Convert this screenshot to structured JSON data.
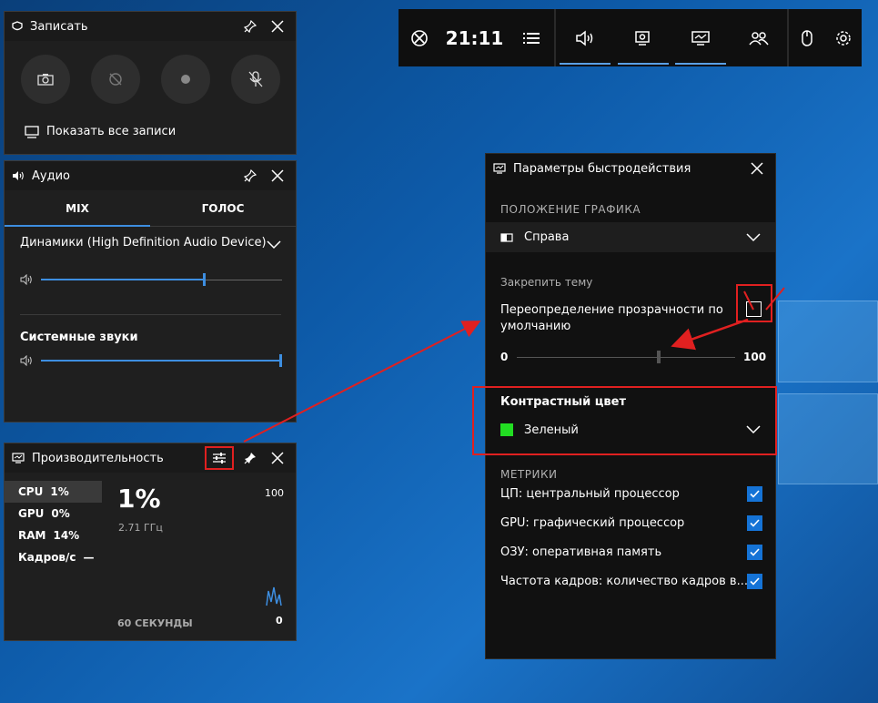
{
  "topbar": {
    "time": "21:11"
  },
  "record": {
    "title": "Записать",
    "show_all": "Показать все записи"
  },
  "audio": {
    "title": "Аудио",
    "tab_mix": "MIX",
    "tab_voice": "ГОЛОС",
    "device": "Динамики (High Definition Audio Device)",
    "system_sounds": "Системные звуки",
    "device_volume": 0.67,
    "system_volume": 1.0
  },
  "perf": {
    "title": "Производительность",
    "stats": [
      {
        "label": "CPU",
        "value": "1%"
      },
      {
        "label": "GPU",
        "value": "0%"
      },
      {
        "label": "RAM",
        "value": "14%"
      },
      {
        "label": "Кадров/с",
        "value": "—"
      }
    ],
    "big_value": "1%",
    "freq": "2.71 ГГц",
    "max": "100",
    "min": "0",
    "duration": "60 СЕКУНДЫ"
  },
  "settings": {
    "title": "Параметры быстродействия",
    "section_position": "ПОЛОЖЕНИЕ ГРАФИКА",
    "position_value": "Справа",
    "lock_theme": "Закрепить тему",
    "transparency_label_1": "Переопределение прозрачности по",
    "transparency_label_2": "умолчанию",
    "slider_min": "0",
    "slider_max": "100",
    "transparency_value": 0.64,
    "contrast_title": "Контрастный цвет",
    "contrast_value": "Зеленый",
    "contrast_color": "#22dd22",
    "section_metrics": "МЕТРИКИ",
    "metrics": [
      "ЦП: центральный процессор",
      "GPU: графический процессор",
      "ОЗУ: оперативная память",
      "Частота кадров: количество кадров в..."
    ]
  },
  "colors": {
    "accent": "#3d8ee0",
    "annotation": "#e02020"
  }
}
